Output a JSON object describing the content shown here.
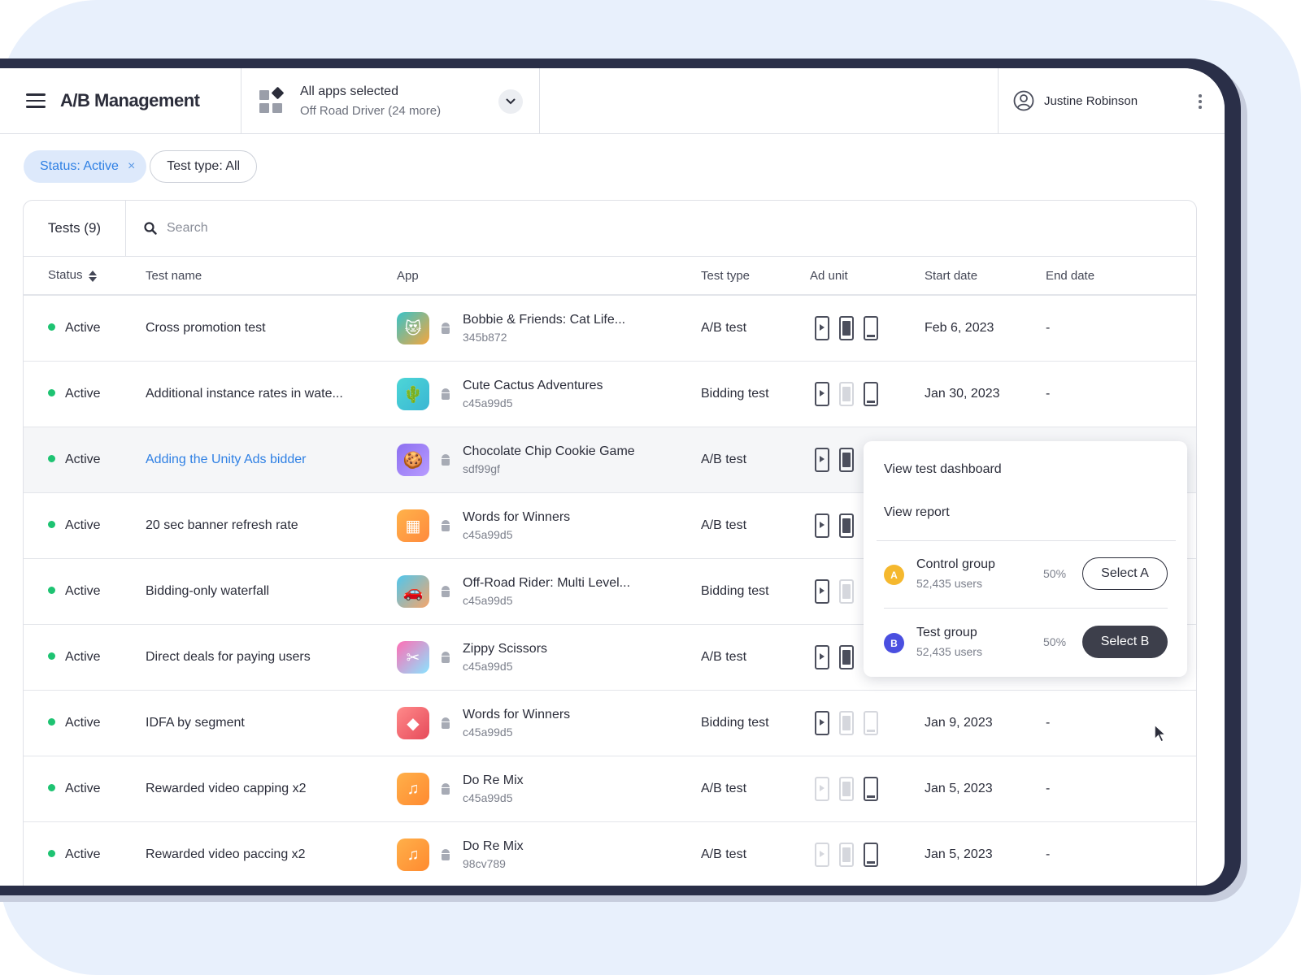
{
  "header": {
    "title": "A/B Management",
    "app_selector": {
      "title": "All apps selected",
      "subtitle": "Off Road Driver (24 more)"
    },
    "user_name": "Justine Robinson"
  },
  "filters": [
    {
      "label": "Status: Active",
      "active": true,
      "remove_icon": "×"
    },
    {
      "label": "Test type: All",
      "active": false
    }
  ],
  "toolbar": {
    "tab_label": "Tests (9)",
    "search_placeholder": "Search"
  },
  "table": {
    "columns": [
      "Status",
      "Test name",
      "App",
      "Test type",
      "Ad unit",
      "Start date",
      "End date"
    ],
    "rows": [
      {
        "status": "Active",
        "name": "Cross promotion test",
        "app_name": "Bobbie & Friends: Cat Life...",
        "app_id": "345b872",
        "type": "A/B test",
        "start": "Feb 6, 2023",
        "end": "-"
      },
      {
        "status": "Active",
        "name": "Additional instance rates in wate...",
        "app_name": "Cute Cactus Adventures",
        "app_id": "c45a99d5",
        "type": "Bidding test",
        "start": "Jan 30, 2023",
        "end": "-"
      },
      {
        "status": "Active",
        "name": "Adding the Unity Ads bidder",
        "app_name": "Chocolate Chip Cookie Game",
        "app_id": "sdf99gf",
        "type": "A/B test",
        "start": "",
        "end": ""
      },
      {
        "status": "Active",
        "name": "20 sec banner refresh rate",
        "app_name": "Words for Winners",
        "app_id": "c45a99d5",
        "type": "A/B test",
        "start": "",
        "end": ""
      },
      {
        "status": "Active",
        "name": "Bidding-only waterfall",
        "app_name": "Off-Road Rider: Multi Level...",
        "app_id": "c45a99d5",
        "type": "Bidding test",
        "start": "",
        "end": ""
      },
      {
        "status": "Active",
        "name": "Direct deals for paying users",
        "app_name": "Zippy Scissors",
        "app_id": "c45a99d5",
        "type": "A/B test",
        "start": "",
        "end": ""
      },
      {
        "status": "Active",
        "name": "IDFA by segment",
        "app_name": "Words for Winners",
        "app_id": "c45a99d5",
        "type": "Bidding test",
        "start": "Jan 9, 2023",
        "end": "-"
      },
      {
        "status": "Active",
        "name": "Rewarded video capping x2",
        "app_name": "Do Re Mix",
        "app_id": "c45a99d5",
        "type": "A/B test",
        "start": "Jan 5, 2023",
        "end": "-"
      },
      {
        "status": "Active",
        "name": "Rewarded video paccing x2",
        "app_name": "Do Re Mix",
        "app_id": "98cv789",
        "type": "A/B test",
        "start": "Jan 5, 2023",
        "end": "-"
      }
    ]
  },
  "context_menu": {
    "items": [
      "View test dashboard",
      "View report"
    ],
    "groups": [
      {
        "badge": "A",
        "name": "Control group",
        "users": "52,435 users",
        "pct": "50%",
        "button": "Select A",
        "color": "#f5b82e"
      },
      {
        "badge": "B",
        "name": "Test group",
        "users": "52,435 users",
        "pct": "50%",
        "button": "Select B",
        "color": "#4a4fe0"
      }
    ]
  },
  "colors": {
    "accent": "#2f80e4",
    "active_dot": "#1ec372",
    "chip_bg": "#dde9fb"
  }
}
